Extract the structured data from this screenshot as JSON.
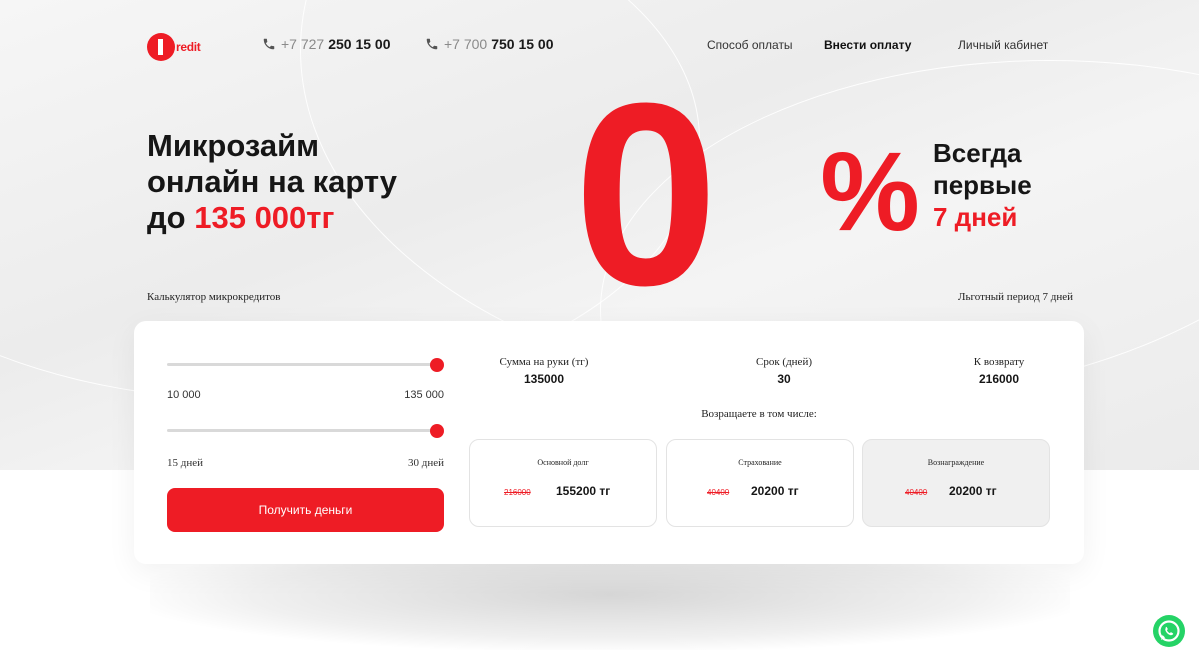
{
  "header": {
    "logo_text": "redit",
    "phone1_prefix": "+7 727",
    "phone1_main": "250 15 00",
    "phone2_prefix": "+7 700",
    "phone2_main": "750 15 00",
    "nav": {
      "payment_method": "Способ оплаты",
      "make_payment": "Внести оплату",
      "account": "Личный кабинет"
    }
  },
  "hero": {
    "title_line1": "Микрозайм",
    "title_line2": "онлайн на карту",
    "title_line3_prefix": "до ",
    "title_line3_amount": "135 000тг",
    "big_zero": "0",
    "percent": "%",
    "always_line1": "Всегда",
    "always_line2": "первые",
    "always_line3": "7 дней"
  },
  "calculator": {
    "label": "Калькулятор микрокредитов",
    "grace_label": "Льготный период 7 дней",
    "amount_slider": {
      "min_label": "10 000",
      "max_label": "135 000",
      "value_fraction": 1.0
    },
    "term_slider": {
      "min_label": "15 дней",
      "max_label": "30 дней",
      "value_fraction": 1.0
    },
    "button_label": "Получить деньги",
    "stats": [
      {
        "label": "Сумма на руки (тг)",
        "value": "135000"
      },
      {
        "label": "Срок (дней)",
        "value": "30"
      },
      {
        "label": "К возврату",
        "value": "216000"
      }
    ],
    "including_label": "Возращаете в том числе:",
    "breakdown": [
      {
        "label": "Основной долг",
        "old": "216000",
        "new": "155200 тг"
      },
      {
        "label": "Страхование",
        "old": "40400",
        "new": "20200 тг"
      },
      {
        "label": "Вознаграждение",
        "old": "40400",
        "new": "20200 тг"
      }
    ]
  },
  "colors": {
    "accent": "#ee1c25",
    "text": "#161616",
    "whatsapp": "#25d366"
  },
  "icons": {
    "phone": "phone-icon",
    "whatsapp": "whatsapp-icon"
  }
}
